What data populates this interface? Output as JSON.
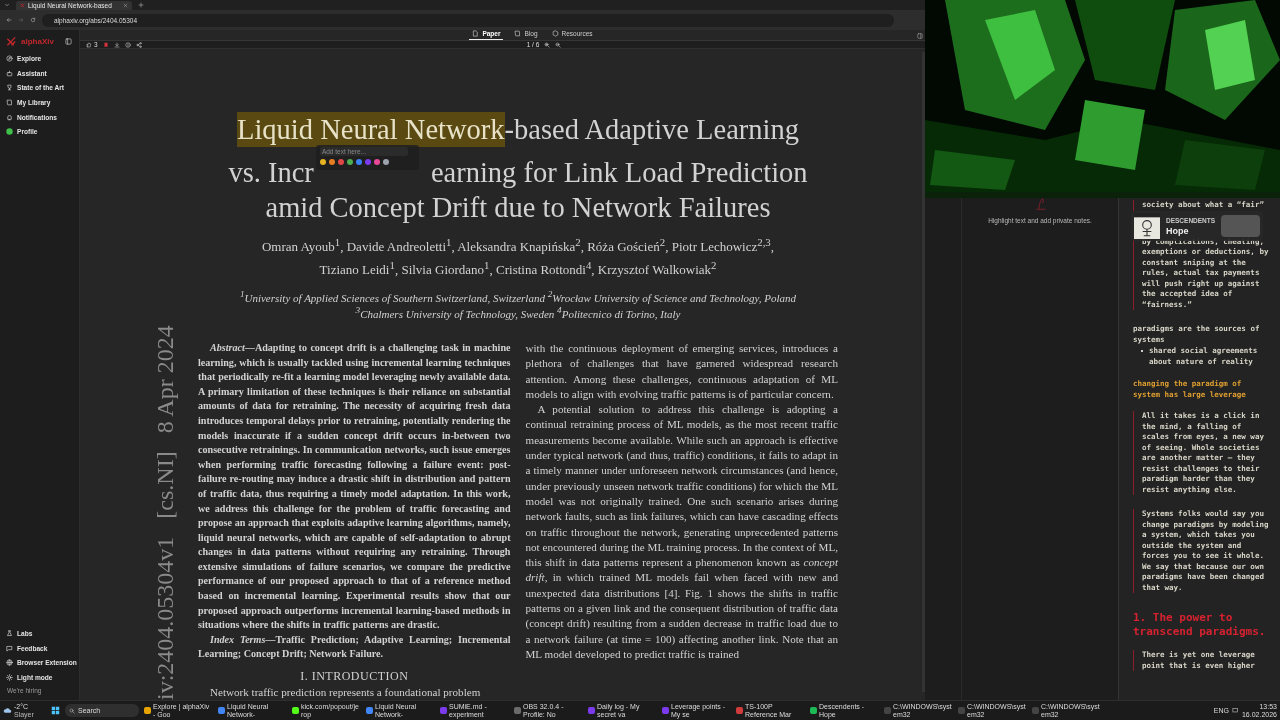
{
  "browser": {
    "tabs": [
      {
        "title": "Liquid Neural Network-based",
        "selected": true
      }
    ],
    "address": "alphaxiv.org/abs/2404.05304"
  },
  "sidebar": {
    "brand": "alphaXiv",
    "items": [
      {
        "kind": "compass",
        "label": "Explore"
      },
      {
        "kind": "robot",
        "label": "Assistant"
      },
      {
        "kind": "trophy",
        "label": "State of the Art"
      },
      {
        "kind": "book",
        "label": "My Library"
      },
      {
        "kind": "bell",
        "label": "Notifications"
      },
      {
        "kind": "avatar",
        "label": "Profile"
      }
    ],
    "footer_items": [
      {
        "kind": "flask",
        "label": "Labs"
      },
      {
        "kind": "chat",
        "label": "Feedback"
      },
      {
        "kind": "globe",
        "label": "Browser Extension"
      },
      {
        "kind": "sun",
        "label": "Light mode"
      }
    ],
    "hiring": "We're hiring"
  },
  "toolbar": {
    "views": [
      {
        "kind": "doc",
        "label": "Paper",
        "selected": true
      },
      {
        "kind": "book",
        "label": "Blog",
        "selected": false
      },
      {
        "kind": "box",
        "label": "Resources",
        "selected": false
      }
    ],
    "likes": "3",
    "bookmarked": true,
    "page": "1 / 6"
  },
  "paper": {
    "title_lines": [
      [
        {
          "kind": "text",
          "text": "Liquid Neural Network",
          "highlighted": true
        },
        {
          "kind": "text",
          "text": "-based Adaptive Learning",
          "highlighted": false
        }
      ],
      [
        {
          "kind": "text",
          "text": "vs. Incr",
          "highlighted": false
        },
        {
          "kind": "popup"
        },
        {
          "kind": "text",
          "text": "earning for Link Load Prediction",
          "highlighted": false
        }
      ],
      [
        {
          "kind": "text",
          "text": "amid Concept Drift due to Network Failures",
          "highlighted": false
        }
      ]
    ],
    "highlight_popup": {
      "placeholder": "Add text here...",
      "colors": [
        {
          "color": "#e6b422"
        },
        {
          "color": "#e67e22"
        },
        {
          "color": "#e04848"
        },
        {
          "color": "#4caf50"
        },
        {
          "color": "#3b82f6"
        },
        {
          "color": "#7c3aed"
        },
        {
          "color": "#ec4899"
        },
        {
          "color": "#9ca3af"
        }
      ]
    },
    "authors": [
      "Omran Ayoub$^{1}$, Davide Andreoletti$^{1}$, Aleksandra Knapińska$^{2}$, Róża Goścień$^{2}$, Piotr Lechowicz$^{2,3}$,",
      "Tiziano Leidi$^{1}$, Silvia Giordano$^{1}$, Cristina Rottondi$^{4}$, Krzysztof Walkowiak$^{2}$"
    ],
    "affiliations": [
      "$^{1}$University of Applied Sciences of Southern Switzerland, Switzerland $^{2}$Wrocław University of Science and Technology, Poland",
      "$^{3}$Chalmers University of Technology, Sweden $^{4}$Politecnico di Torino, Italy"
    ],
    "arxiv_stamp": "iv:2404.05304v1   [cs.NI]   8 Apr 2024",
    "left_column": [
      {
        "kind": "abstract",
        "text": "*Abstract*—Adapting to concept drift is a challenging task in machine learning, which is usually tackled using incremental learning techniques that periodically re-fit a learning model leveraging newly available data. A primary limitation of these techniques is their reliance on substantial amounts of data for retraining. The necessity of acquiring fresh data introduces temporal delays prior to retraining, potentially rendering the models inaccurate if a sudden concept drift occurs in-between two consecutive retrainings. In communication networks, such issue emerges when performing traffic forecasting following a failure event: post-failure re-routing may induce a drastic shift in distribution and pattern of traffic data, thus requiring a timely model adaptation. In this work, we address this challenge for the problem of traffic forecasting and propose an approach that exploits adaptive learning algorithms, namely, liquid neural networks, which are capable of self-adaptation to abrupt changes in data patterns without requiring any retraining. Through extensive simulations of failure scenarios, we compare the predictive performance of our proposed approach to that of a reference method based on incremental learning. Experimental results show that our proposed approach outperforms incremental learning-based methods in situations where the shifts in traffic patterns are drastic."
      },
      {
        "kind": "abstract",
        "text": "*Index Terms*—Traffic Prediction; Adaptive Learning; Incremental Learning; Concept Drift; Network Failure."
      },
      {
        "kind": "heading",
        "text": "I. INTRODUCTION"
      },
      {
        "kind": "para",
        "text": "Network traffic prediction represents a foundational problem"
      }
    ],
    "right_column": [
      {
        "kind": "cont",
        "text": "with the continuous deployment of emerging services, introduces a plethora of challenges that have garnered widespread research attention. Among these challenges, continuous adaptation of ML models to align with evolving traffic patterns is of particular concern."
      },
      {
        "kind": "para",
        "text": "A potential solution to address this challenge is adopting a continual retraining process of ML models, as the most recent traffic measurements become available. While such an approach is effective under typical network (and thus, traffic) conditions, it fails to adapt in a timely manner under unforeseen network circumstances (and hence, under previously unseen network traffic conditions) for which the ML model was not originally trained. One such scenario arises during network faults, such as link failures, which can have cascading effects on traffic throughout the network, generating unprecedented patterns not encountered during the ML training process. In the context of ML, this shift in data patterns represent a phenomenon known as *concept drift*, in which trained ML models fail when faced with new and unexpected data distributions [4]. Fig. 1 shows the shifts in traffic patterns on a given link and the consequent distribution of traffic data (concept drift) resulting from a sudden decrease in traffic load due to a network failure (at time = 100) affecting another link. Note that an ML model developed to predict traffic is trained"
      }
    ]
  },
  "notes": {
    "hint": "Highlight text and add private notes."
  },
  "editor": {
    "blocks": [
      {
        "kind": "quote",
        "text": "society about what a “fair”"
      },
      {
        "kind": "quote-covered",
        "text": "by complications, cheating, exemptions or deductions, by constant sniping at the rules, actual tax payments will push right up against the accepted idea of “fairness.”"
      },
      {
        "kind": "text",
        "text": "paradigms are the sources of systems"
      },
      {
        "kind": "bullet",
        "text": "shared social agreements about nature of reality"
      },
      {
        "kind": "highlight",
        "text": "changing the paradigm of system has large leverage"
      },
      {
        "kind": "quote",
        "text": "All it takes is a click in the mind, a falling of scales from eyes, a new way of seeing. Whole societies are another matter — they resist challenges to their paradigm harder than they resist anything else."
      },
      {
        "kind": "quote",
        "text": "Systems folks would say you change paradigms by modeling a system, which takes you outside the system and forces you to see it whole. We say that because our own paradigms have been changed that way."
      },
      {
        "kind": "heading",
        "text": "1. The power to transcend paradigms."
      },
      {
        "kind": "quote",
        "text": "There is yet one leverage point that is even higher"
      }
    ]
  },
  "media": {
    "artist": "DESCENDENTS",
    "title": "Hope"
  },
  "taskbar": {
    "temp": "-2°C",
    "weather": "Slayer",
    "search": "Search",
    "apps": [
      {
        "color": "#e8a400",
        "label": "Explore | alphaXiv - Goo"
      },
      {
        "color": "#4285f4",
        "label": "Liquid Neural Network-"
      },
      {
        "color": "#53fc18",
        "label": "kick.com/popout/jerop"
      },
      {
        "color": "#4285f4",
        "label": "Liquid Neural Network-"
      },
      {
        "color": "#7c3aed",
        "label": "SUMiE.md - experiment"
      },
      {
        "color": "#6b6b6b",
        "label": "OBS 32.0.4 - Profile: No"
      },
      {
        "color": "#7c3aed",
        "label": "Daily log - My secret va"
      },
      {
        "color": "#7c3aed",
        "label": "Leverage points - My se"
      },
      {
        "color": "#d23b3b",
        "label": "TS-100P Reference Mar"
      },
      {
        "color": "#1db954",
        "label": "Descendents - Hope"
      },
      {
        "color": "#444444",
        "label": "C:\\WINDOWS\\system32"
      },
      {
        "color": "#444444",
        "label": "C:\\WINDOWS\\system32"
      },
      {
        "color": "#444444",
        "label": "C:\\WINDOWS\\system32"
      }
    ],
    "lang": "ENG",
    "time": "13:53",
    "date": "16.02.2026"
  }
}
